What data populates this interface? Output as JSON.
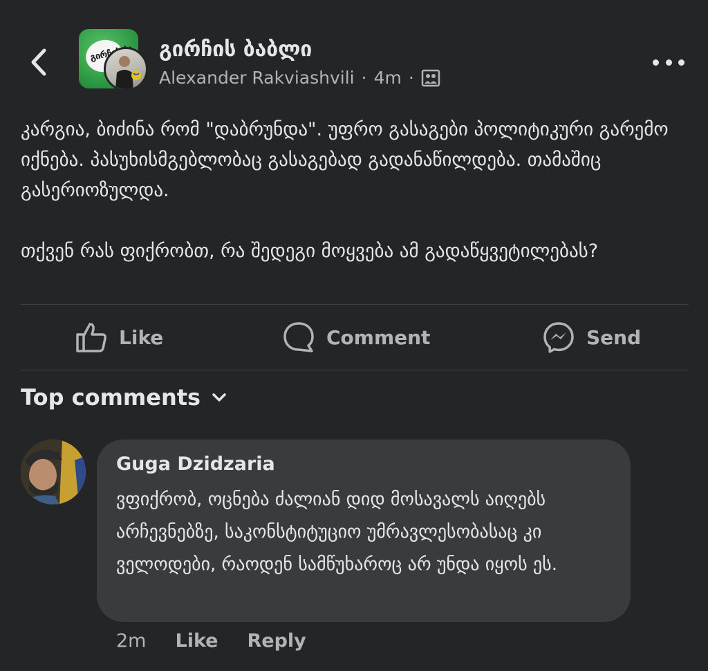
{
  "header": {
    "group_name": "გირჩის ბაბლი",
    "author_name": "Alexander Rakviashvili",
    "separator": "·",
    "post_time": "4m",
    "group_avatar_text": "გირჩის ბა",
    "icons": {
      "back": "chevron-left-icon",
      "audience": "members-icon",
      "more": "more-icon"
    }
  },
  "post": {
    "paragraph1": "კარგია, ბიძინა რომ \"დაბრუნდა\". უფრო გასაგები პოლიტიკური გარემო იქნება. პასუხისმგებლობაც გასაგებად გადანაწილდება. თამაშიც გასერიოზულდა.",
    "paragraph2": "თქვენ რას ფიქრობთ, რა შედეგი მოყვება ამ გადაწყვეტილებას?"
  },
  "actions": {
    "like_label": "Like",
    "comment_label": "Comment",
    "send_label": "Send",
    "icons": {
      "like": "thumbs-up-icon",
      "comment": "comment-icon",
      "send": "messenger-icon"
    }
  },
  "comments_section": {
    "sort_label": "Top comments",
    "sort_icon": "chevron-down-icon",
    "comments": [
      {
        "author": "Guga Dzidzaria",
        "text": "ვფიქრობ, ოცნება ძალიან დიდ მოსავალს აიღებს არჩევნებზე, საკონსტიტუციო უმრავლესობასაც კი ველოდები, რაოდენ სამწუხაროც არ უნდა იყოს ეს.",
        "time": "2m",
        "like_label": "Like",
        "reply_label": "Reply"
      }
    ]
  },
  "colors": {
    "background": "#242526",
    "comment_bubble": "#3a3b3c",
    "primary_text": "#e4e6eb",
    "secondary_text": "#b0b3b8",
    "divider": "#3e4042",
    "group_avatar_green": "#2e9b45"
  }
}
